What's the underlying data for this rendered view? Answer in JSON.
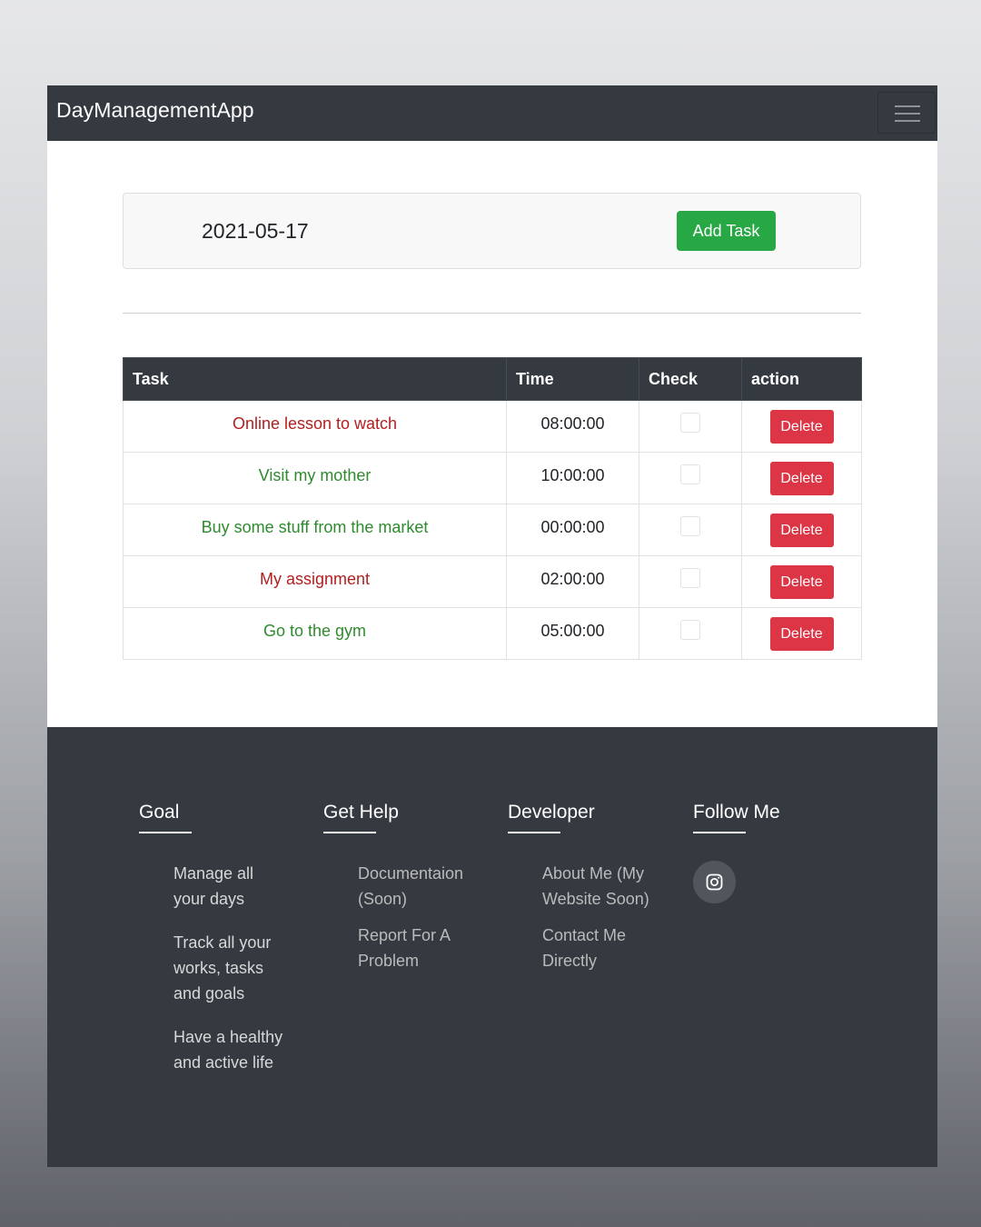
{
  "navbar": {
    "brand": "DayManagementApp",
    "toggler_icon": "hamburger-menu-icon"
  },
  "date_card": {
    "date": "2021-05-17",
    "add_label": "Add Task"
  },
  "table": {
    "headers": [
      "Task",
      "Time",
      "Check",
      "action"
    ],
    "rows": [
      {
        "task": "Online lesson to watch",
        "time": "08:00:00",
        "status_color": "#b21f1f",
        "checked": false,
        "delete_label": "Delete"
      },
      {
        "task": "Visit my mother",
        "time": "10:00:00",
        "status_color": "#2e8b2e",
        "checked": false,
        "delete_label": "Delete"
      },
      {
        "task": "Buy some stuff from the market",
        "time": "00:00:00",
        "status_color": "#2e8b2e",
        "checked": false,
        "delete_label": "Delete"
      },
      {
        "task": "My assignment",
        "time": "02:00:00",
        "status_color": "#b21f1f",
        "checked": false,
        "delete_label": "Delete"
      },
      {
        "task": "Go to the gym",
        "time": "05:00:00",
        "status_color": "#2e8b2e",
        "checked": false,
        "delete_label": "Delete"
      }
    ]
  },
  "footer": {
    "goal": {
      "title": "Goal",
      "items": [
        "Manage all your days",
        "Track all your works, tasks and goals",
        "Have a healthy and active life"
      ]
    },
    "help": {
      "title": "Get Help",
      "items": [
        "Documentaion (Soon)",
        "Report For A Problem"
      ]
    },
    "developer": {
      "title": "Developer",
      "items": [
        "About Me (My Website Soon)",
        "Contact Me Directly"
      ]
    },
    "follow": {
      "title": "Follow Me",
      "icon": "instagram-icon"
    }
  },
  "colors": {
    "navbar": "#343a40",
    "success": "#28a745",
    "danger": "#dc3545"
  }
}
